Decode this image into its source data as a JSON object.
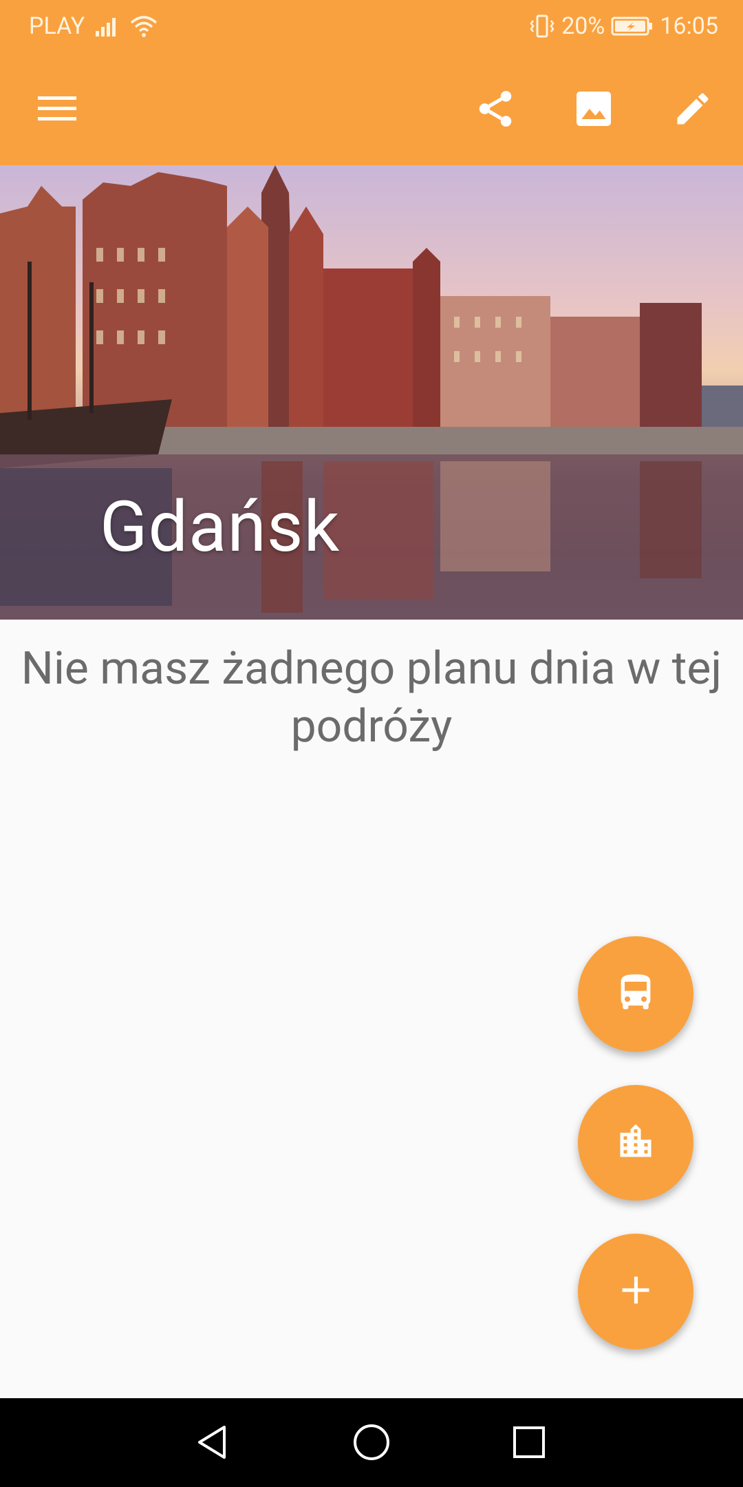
{
  "status_bar": {
    "carrier": "PLAY",
    "battery": "20%",
    "time": "16:05"
  },
  "app_bar": {
    "icons": [
      "menu-icon",
      "share-icon",
      "image-icon",
      "edit-icon"
    ]
  },
  "hero": {
    "city": "Gdańsk"
  },
  "empty_state": {
    "message": "Nie masz żadnego planu dnia w tej podróży"
  },
  "fabs": [
    {
      "icon": "bus-icon"
    },
    {
      "icon": "city-icon"
    },
    {
      "icon": "add-icon"
    }
  ],
  "nav": {
    "icons": [
      "back-icon",
      "home-icon",
      "recents-icon"
    ]
  },
  "colors": {
    "accent": "#f9a13f",
    "background": "#fafafa",
    "text_muted": "#6b6b6b"
  }
}
